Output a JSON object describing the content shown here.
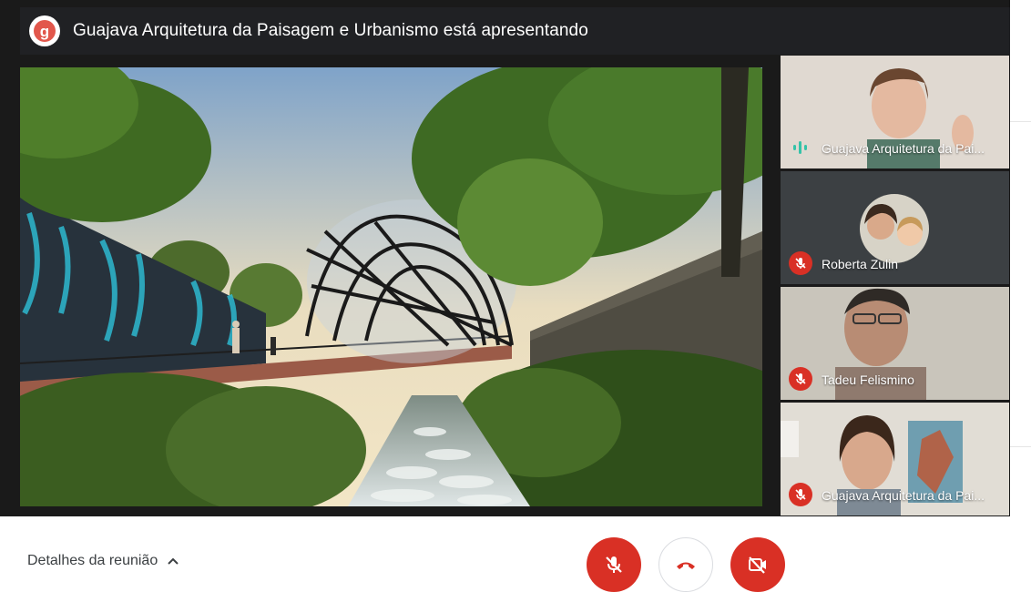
{
  "banner": {
    "logo_letter": "g",
    "text": "Guajava Arquitetura da Paisagem e Urbanismo está apresentando"
  },
  "participants": [
    {
      "name": "Guajava Arquitetura da Pai...",
      "status": "speaking"
    },
    {
      "name": "Roberta Zulin",
      "status": "muted"
    },
    {
      "name": "Tadeu Felismino",
      "status": "muted"
    },
    {
      "name": "Guajava Arquitetura da Pai...",
      "status": "muted"
    }
  ],
  "footer": {
    "details_label": "Detalhes da reunião"
  },
  "colors": {
    "danger": "#d93025",
    "speaking": "#34c3a8",
    "banner_bg": "#202124"
  }
}
